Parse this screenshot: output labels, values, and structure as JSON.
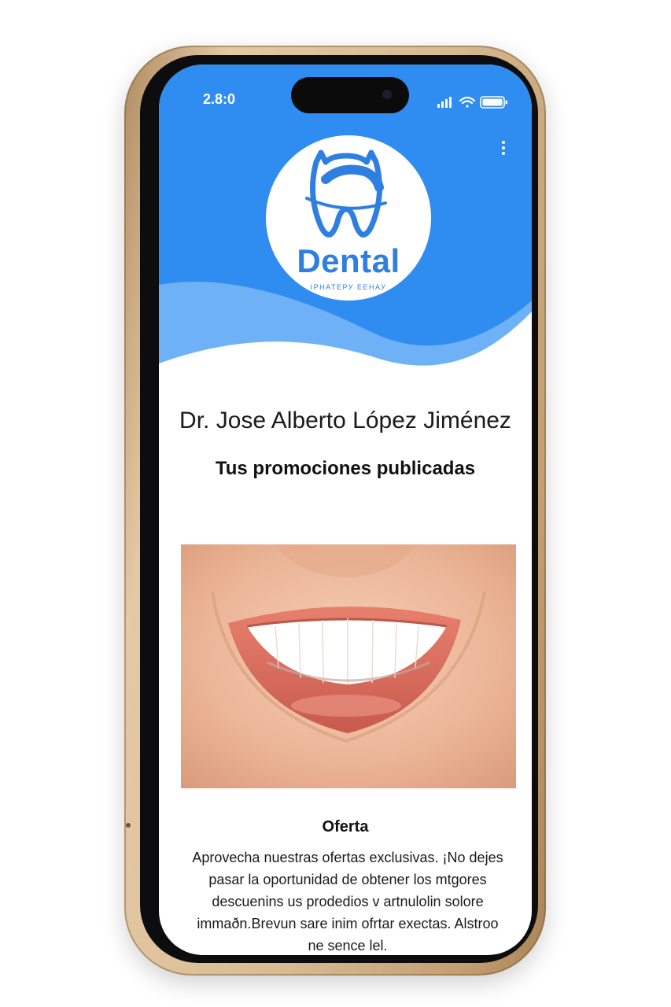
{
  "status_bar": {
    "time": "2.8:0"
  },
  "header": {
    "menu_icon": "more-vertical-icon",
    "logo": {
      "title": "Dental",
      "subtitle": "ІРНАТЕРУ ЕЕНАУ",
      "icon": "tooth-icon"
    }
  },
  "profile": {
    "doctor_name": "Dr. Jose Alberto López Jiménez",
    "section_title": "Tus promociones publicadas"
  },
  "promotion": {
    "image": "smile-photo",
    "title": "Oferta",
    "description": "Aprovecha nuestras ofertas exclusivas. ¡No dejes pasar la oportunidad de obtener los mtgores descuenins us prodedios v artnulolin solore immaðn.Brevun sare inim ofrtar exectas. Alstroo ne sence lel."
  },
  "colors": {
    "primary": "#2f8cf0",
    "wave_light": "#6fb1f7",
    "logo_blue": "#2f7fe0",
    "frame_gold": "#d8bb93"
  }
}
